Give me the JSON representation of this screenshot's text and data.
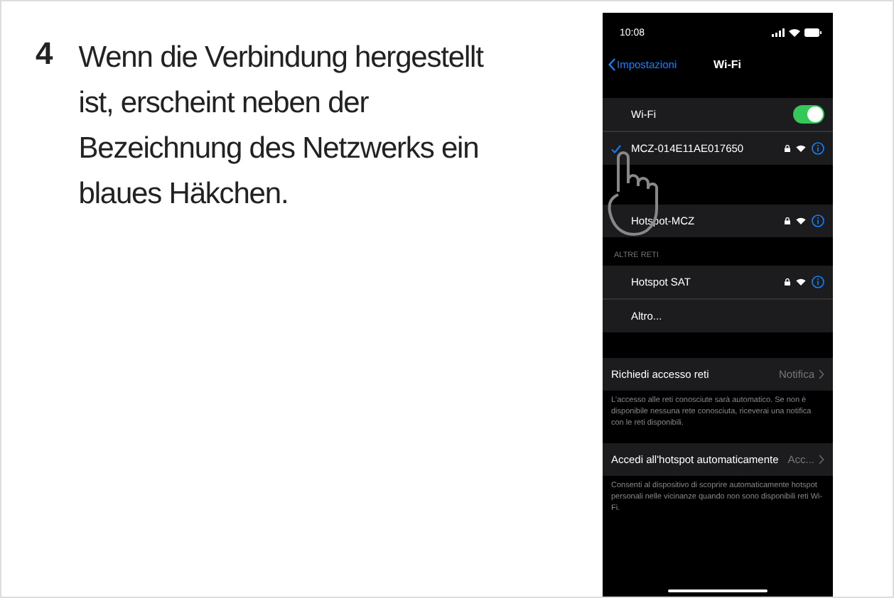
{
  "step": {
    "number": "4",
    "text": "Wenn die Verbindung hergestellt ist, erscheint neben der Bezeichnung des Netzwerks ein blaues Häkchen."
  },
  "phone": {
    "status_bar": {
      "time": "10:08"
    },
    "nav": {
      "back": "Impostazioni",
      "title": "Wi-Fi"
    },
    "groups": [
      {
        "rows": [
          {
            "kind": "toggle",
            "label": "Wi-Fi",
            "on": true
          },
          {
            "kind": "network",
            "label": "MCZ-014E11AE017650",
            "checked": true
          }
        ]
      },
      {
        "rows": [
          {
            "kind": "network",
            "label": "Hotspot-MCZ",
            "checked": false
          }
        ]
      },
      {
        "header": "ALTRE RETI",
        "rows": [
          {
            "kind": "network",
            "label": "Hotspot SAT",
            "checked": false
          },
          {
            "kind": "plain",
            "label": "Altro..."
          }
        ]
      },
      {
        "rows": [
          {
            "kind": "value",
            "label": "Richiedi accesso reti",
            "value": "Notifica"
          }
        ],
        "footer": "L'accesso alle reti conosciute sarà automatico. Se non è disponibile nessuna rete conosciuta, riceverai una notifica con le reti disponibili."
      },
      {
        "rows": [
          {
            "kind": "value",
            "label": "Accedi all'hotspot automaticamente",
            "value": "Acc..."
          }
        ],
        "footer": "Consenti al dispositivo di scoprire automaticamente hotspot personali nelle vicinanze quando non sono disponibili reti Wi-Fi."
      }
    ]
  }
}
